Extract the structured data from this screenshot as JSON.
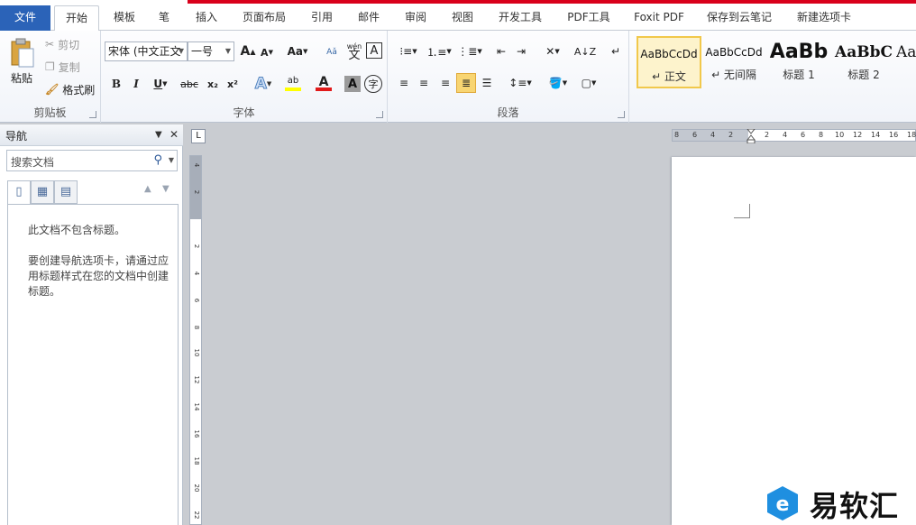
{
  "tabs": {
    "file": "文件",
    "home": "开始",
    "template": "模板",
    "pen": "笔",
    "insert": "插入",
    "layout": "页面布局",
    "references": "引用",
    "mailings": "邮件",
    "review": "审阅",
    "view": "视图",
    "developer": "开发工具",
    "pdf": "PDF工具",
    "foxit": "Foxit PDF",
    "save_cloud": "保存到云笔记",
    "new_tab": "新建选项卡"
  },
  "clipboard": {
    "paste": "粘贴",
    "cut": "剪切",
    "copy": "复制",
    "format_painter": "格式刷",
    "group_label": "剪贴板"
  },
  "font": {
    "font_name": "宋体 (中文正文",
    "font_size": "一号",
    "change_case": "Aa",
    "phonetic_char": "wén",
    "phonetic_base": "文",
    "border_char": "A",
    "bold": "B",
    "italic": "I",
    "underline": "U",
    "strike": "abc",
    "subscript": "x₂",
    "superscript": "x²",
    "effects": "A",
    "highlight": "ab",
    "font_color": "A",
    "shading": "A",
    "enclose": "字",
    "grow": "A",
    "shrink": "A",
    "group_label": "字体"
  },
  "paragraph": {
    "group_label": "段落"
  },
  "styles": {
    "items": [
      {
        "sample": "AaBbCcDd",
        "name": "↵ 正文"
      },
      {
        "sample": "AaBbCcDd",
        "name": "↵ 无间隔"
      },
      {
        "sample": "AaBb",
        "name": "标题 1"
      },
      {
        "sample": "AaBbC",
        "name": "标题 2"
      },
      {
        "sample": "Aa",
        "name": ""
      }
    ]
  },
  "nav": {
    "title": "导航",
    "search_placeholder": "搜索文档",
    "no_headings": "此文档不包含标题。",
    "instructions": "要创建导航选项卡，请通过应用标题样式在您的文档中创建标题。"
  },
  "ruler": {
    "corner": "L",
    "h_ticks": [
      "8",
      "6",
      "4",
      "2",
      "2",
      "4",
      "6",
      "8",
      "10",
      "12",
      "14",
      "16",
      "18"
    ],
    "v_ticks": [
      "4",
      "2",
      "2",
      "4",
      "6",
      "8",
      "10",
      "12",
      "14",
      "16",
      "18",
      "20",
      "22"
    ]
  },
  "watermark": {
    "text": "易软汇"
  },
  "colors": {
    "file_tab": "#2b63b8",
    "accent_red": "#d9001b",
    "style_selected": "#fdf3cc",
    "watermark_blue": "#1f8fe0"
  }
}
